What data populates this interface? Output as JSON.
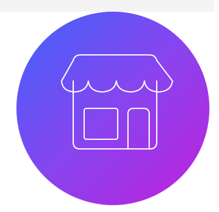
{
  "icon": {
    "name": "storefront-icon",
    "stroke_color": "#ffffff"
  },
  "colors": {
    "page_background": "#ffffff",
    "top_strip": "#f4f4f4",
    "gradient_start": "#3f63fb",
    "gradient_mid": "#8a43ee",
    "gradient_end": "#c020db"
  }
}
